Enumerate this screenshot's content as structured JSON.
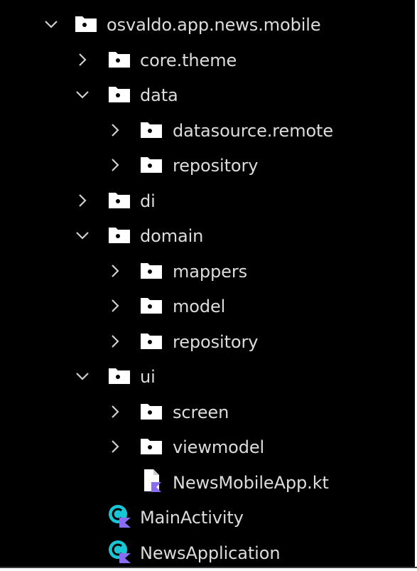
{
  "project_tree": {
    "nodes": [
      {
        "label": "osvaldo.app.news.mobile",
        "state": "expanded",
        "icon": "package-folder-icon"
      },
      {
        "label": "core.theme",
        "state": "collapsed",
        "icon": "package-folder-icon"
      },
      {
        "label": "data",
        "state": "expanded",
        "icon": "package-folder-icon"
      },
      {
        "label": "datasource.remote",
        "state": "collapsed",
        "icon": "package-folder-icon"
      },
      {
        "label": "repository",
        "state": "collapsed",
        "icon": "package-folder-icon"
      },
      {
        "label": "di",
        "state": "collapsed",
        "icon": "package-folder-icon"
      },
      {
        "label": "domain",
        "state": "expanded",
        "icon": "package-folder-icon"
      },
      {
        "label": "mappers",
        "state": "collapsed",
        "icon": "package-folder-icon"
      },
      {
        "label": "model",
        "state": "collapsed",
        "icon": "package-folder-icon"
      },
      {
        "label": "repository",
        "state": "collapsed",
        "icon": "package-folder-icon"
      },
      {
        "label": "ui",
        "state": "expanded",
        "icon": "package-folder-icon"
      },
      {
        "label": "screen",
        "state": "collapsed",
        "icon": "package-folder-icon"
      },
      {
        "label": "viewmodel",
        "state": "collapsed",
        "icon": "package-folder-icon"
      },
      {
        "label": "NewsMobileApp.kt",
        "state": "leaf",
        "icon": "kotlin-file-icon"
      },
      {
        "label": "MainActivity",
        "state": "leaf",
        "icon": "kotlin-class-icon"
      },
      {
        "label": "NewsApplication",
        "state": "leaf",
        "icon": "kotlin-class-icon"
      }
    ]
  },
  "colors": {
    "background": "#000000",
    "text": "#dcdcdc",
    "chevron": "#cfcfcf",
    "folder": "#ffffff",
    "class_icon_teal": "#19c6d6",
    "kotlin_purple": "#8a6cf0"
  }
}
